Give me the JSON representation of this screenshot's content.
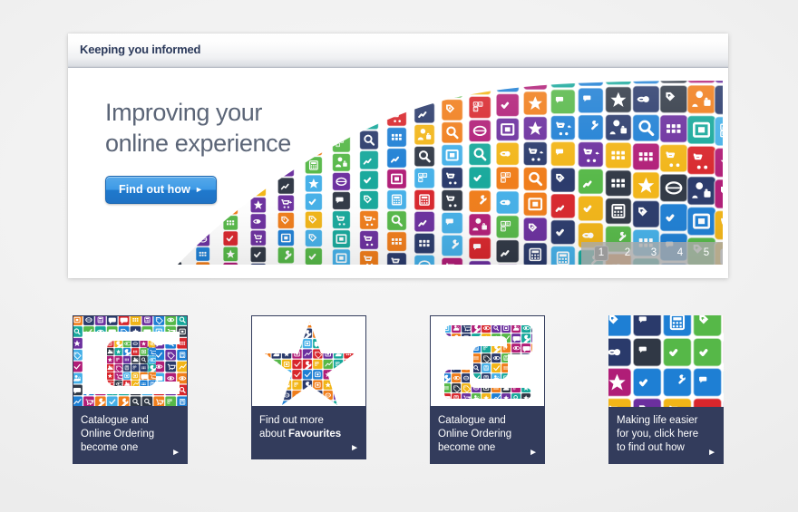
{
  "page": {
    "background_color": "#efefef"
  },
  "panel": {
    "title": "Keeping you informed"
  },
  "banner": {
    "headline_line1": "Improving your",
    "headline_line2": "online experience",
    "cta_label": "Find out how",
    "cta_arrow": "►",
    "cta_color": "#2b8ade",
    "headline_color": "#5b6577",
    "pagination": [
      {
        "label": "1",
        "active": true
      },
      {
        "label": "2",
        "active": false
      },
      {
        "label": "3",
        "active": false
      },
      {
        "label": "4",
        "active": false
      },
      {
        "label": "5",
        "active": false
      }
    ]
  },
  "cards": [
    {
      "name": "catalogue-online-ordering-tablet",
      "caption_line1": "Catalogue and",
      "caption_line2": "Online Ordering",
      "caption_line3": "become one",
      "caption_bold": "",
      "arrow": "►",
      "image": "icon-mosaic-tablet",
      "caption_color": "#333c5c"
    },
    {
      "name": "favourites-star",
      "caption_line1": "Find out more",
      "caption_line2": "about ",
      "caption_line3": "",
      "caption_bold": "Favourites",
      "arrow": "►",
      "image": "icon-mosaic-star",
      "caption_color": "#333c5c"
    },
    {
      "name": "catalogue-online-ordering-interlock",
      "caption_line1": "Catalogue and",
      "caption_line2": "Online Ordering",
      "caption_line3": "become one",
      "caption_bold": "",
      "arrow": "►",
      "image": "icon-mosaic-interlock",
      "caption_color": "#333c5c"
    },
    {
      "name": "making-life-easier",
      "caption_line1": "Making life easier",
      "caption_line2": "for you, click here",
      "caption_line3": "to find out how",
      "caption_bold": "",
      "arrow": "►",
      "image": "icon-grid-closeup",
      "caption_color": "#333c5c"
    }
  ],
  "icon_palette": {
    "magenta": "#b01d77",
    "purple": "#6b2f9e",
    "blue": "#1e7fd4",
    "lightblue": "#45b0e8",
    "green": "#56b848",
    "teal": "#17a89b",
    "orange": "#f07d1a",
    "yellow": "#f2b517",
    "red": "#d8262c",
    "darkgrey": "#303845",
    "navy": "#2a3a6b",
    "white": "#ffffff"
  },
  "icon_glyphs": [
    "star",
    "person-lock",
    "shopping-cart",
    "magnifier",
    "abc-blocks",
    "wrench",
    "cart-arrow",
    "dots-grid",
    "eye",
    "disc",
    "frame",
    "calculator",
    "check-tick",
    "tag",
    "graph",
    "chat"
  ]
}
